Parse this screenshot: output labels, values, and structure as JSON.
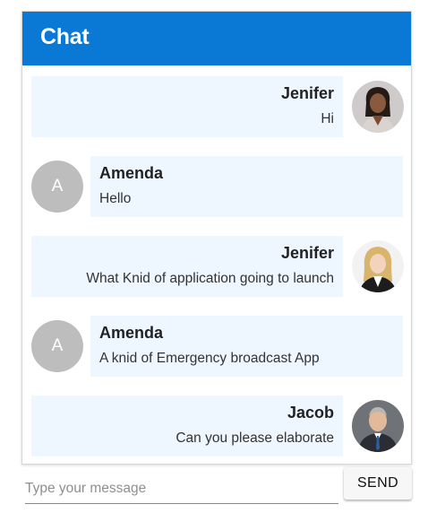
{
  "header": {
    "title": "Chat"
  },
  "messages": [
    {
      "sender": "Jenifer",
      "text": "Hi",
      "side": "right",
      "avatar_icon": "jenifer-photo-avatar"
    },
    {
      "sender": "Amenda",
      "text": "Hello",
      "side": "left",
      "avatar_letter": "A"
    },
    {
      "sender": "Jenifer",
      "text": "What Knid of application going to launch",
      "side": "right",
      "avatar_icon": "blonde-woman-photo-avatar"
    },
    {
      "sender": "Amenda",
      "text": "A knid of Emergency broadcast App",
      "side": "left",
      "avatar_letter": "A"
    },
    {
      "sender": "Jacob",
      "text": "Can you please elaborate",
      "side": "right",
      "avatar_icon": "jacob-photo-avatar"
    }
  ],
  "composer": {
    "placeholder": "Type your message",
    "value": "",
    "send_label": "SEND"
  },
  "colors": {
    "header": "#0a78d5",
    "bubble": "#eef6ff",
    "letter_avatar": "#bdbdbd"
  }
}
